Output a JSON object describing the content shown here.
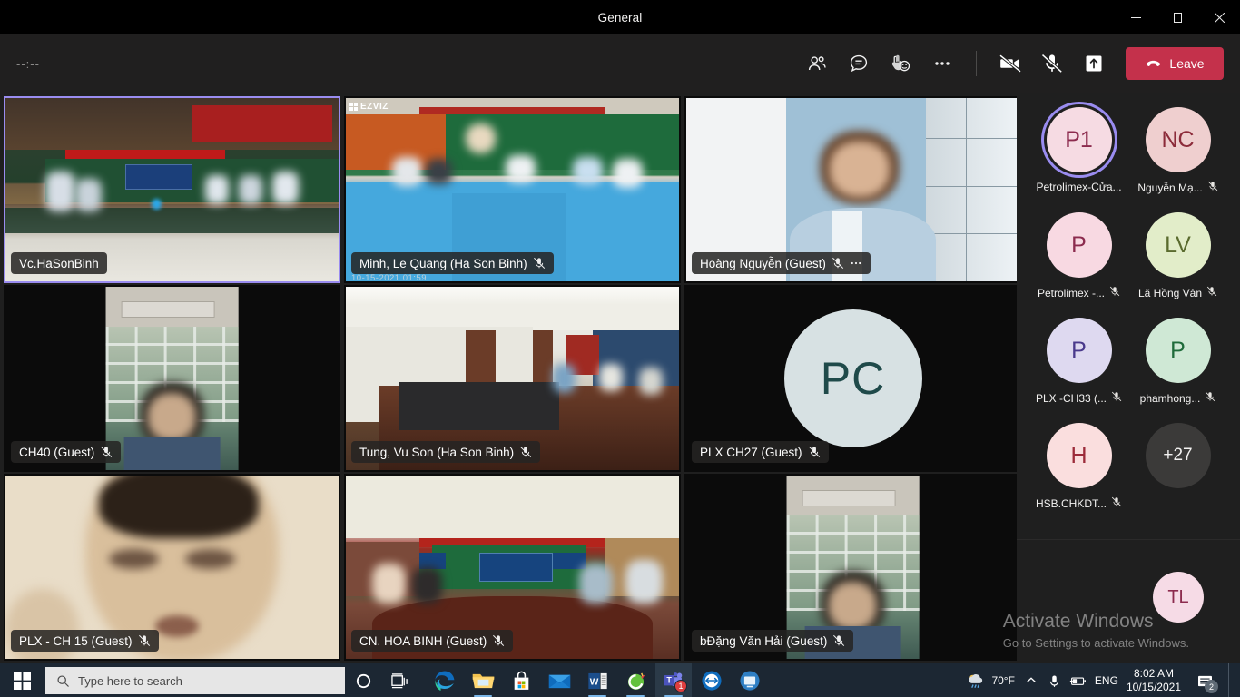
{
  "window": {
    "title": "General",
    "minimize_icon": "minimize-icon",
    "restore_icon": "restore-icon",
    "close_icon": "close-icon"
  },
  "toolbar": {
    "timer": "--:--",
    "people_label": "Show participants",
    "chat_label": "Show conversation",
    "reactions_label": "Reactions",
    "more_label": "More actions",
    "camera_label": "Turn camera on",
    "mic_label": "Unmute",
    "share_label": "Share content",
    "leave_label": "Leave",
    "leave_color": "#c4314b",
    "active_ring_color": "#9a8cf0"
  },
  "tiles": [
    {
      "name": "Vc.HaSonBinh",
      "muted": false,
      "more": false,
      "active": true,
      "scene": "s-room1",
      "layout": "full",
      "watermark": "",
      "timestamp": ""
    },
    {
      "name": "Minh, Le Quang (Ha Son Binh)",
      "muted": true,
      "more": false,
      "active": false,
      "scene": "s-room2",
      "layout": "full",
      "watermark": "EZVIZ",
      "timestamp": "10-15-2021  01:59"
    },
    {
      "name": "Hoàng Nguyễn (Guest)",
      "muted": true,
      "more": true,
      "active": false,
      "scene": "s-room3",
      "layout": "full",
      "watermark": "",
      "timestamp": ""
    },
    {
      "name": "CH40 (Guest)",
      "muted": true,
      "more": false,
      "active": false,
      "scene": "s-win",
      "layout": "portrait",
      "watermark": "",
      "timestamp": ""
    },
    {
      "name": "Tung, Vu Son (Ha Son Binh)",
      "muted": true,
      "more": false,
      "active": false,
      "scene": "s-hall",
      "layout": "full",
      "watermark": "",
      "timestamp": ""
    },
    {
      "name": "PLX CH27 (Guest)",
      "muted": true,
      "more": false,
      "active": false,
      "scene": "s-dark",
      "layout": "avatar",
      "avatar_initials": "PC",
      "avatar_bg": "#d7e1e3",
      "avatar_fg": "#1f4a4a",
      "watermark": "",
      "timestamp": ""
    },
    {
      "name": "PLX - CH 15 (Guest)",
      "muted": true,
      "more": false,
      "active": false,
      "scene": "s-face",
      "layout": "full",
      "watermark": "",
      "timestamp": ""
    },
    {
      "name": "CN. HOA BINH (Guest)",
      "muted": true,
      "more": false,
      "active": false,
      "scene": "s-meet",
      "layout": "full",
      "watermark": "",
      "timestamp": ""
    },
    {
      "name": "bĐặng Văn Hải (Guest)",
      "muted": true,
      "more": false,
      "active": false,
      "scene": "s-win",
      "layout": "portrait",
      "watermark": "",
      "timestamp": ""
    }
  ],
  "rail": {
    "participants": [
      {
        "initials": "P1",
        "label": "Petrolimex-Cửa...",
        "bg": "#f6dbe3",
        "fg": "#8c2b4e",
        "muted": false,
        "speaking": true
      },
      {
        "initials": "NC",
        "label": "Nguyễn Mạ...",
        "bg": "#efcfcf",
        "fg": "#8c2b3a",
        "muted": true,
        "speaking": false
      },
      {
        "initials": "P",
        "label": "Petrolimex -...",
        "bg": "#f8d9e2",
        "fg": "#8c2b4e",
        "muted": true,
        "speaking": false
      },
      {
        "initials": "LV",
        "label": "Lã Hồng Vân",
        "bg": "#e2edc9",
        "fg": "#5a6b2e",
        "muted": true,
        "speaking": false
      },
      {
        "initials": "P",
        "label": "PLX -CH33 (...",
        "bg": "#ded9f0",
        "fg": "#4a3a8c",
        "muted": true,
        "speaking": false
      },
      {
        "initials": "P",
        "label": "phamhong...",
        "bg": "#cfe8d5",
        "fg": "#1f6b3a",
        "muted": true,
        "speaking": false
      },
      {
        "initials": "H",
        "label": "HSB.CHKDT...",
        "bg": "#fadede",
        "fg": "#9c2b3a",
        "muted": true,
        "speaking": false
      },
      {
        "initials": "+27",
        "label": "",
        "bg": "#3b3a39",
        "fg": "#f3f2f1",
        "muted": false,
        "speaking": false,
        "overflow": true
      }
    ],
    "floating_avatar": {
      "initials": "TL",
      "bg": "#f6dbe6",
      "fg": "#8c2b4e"
    }
  },
  "activate_windows": {
    "line1": "Activate Windows",
    "line2": "Go to Settings to activate Windows."
  },
  "taskbar": {
    "start_icon": "windows-start-icon",
    "search_placeholder": "Type here to search",
    "search_icon": "search-icon",
    "cortana_icon": "cortana-icon",
    "taskview_icon": "task-view-icon",
    "apps": [
      {
        "name": "edge-icon",
        "open": false,
        "active": false,
        "badge": ""
      },
      {
        "name": "file-explorer-icon",
        "open": true,
        "active": false,
        "badge": ""
      },
      {
        "name": "microsoft-store-icon",
        "open": false,
        "active": false,
        "badge": ""
      },
      {
        "name": "mail-icon",
        "open": false,
        "active": false,
        "badge": ""
      },
      {
        "name": "word-icon",
        "open": true,
        "active": false,
        "badge": ""
      },
      {
        "name": "unikey-icon",
        "open": true,
        "active": false,
        "badge": ""
      },
      {
        "name": "teams-icon",
        "open": true,
        "active": true,
        "badge": "1"
      },
      {
        "name": "teamviewer-icon",
        "open": false,
        "active": false,
        "badge": ""
      },
      {
        "name": "remote-desktop-icon",
        "open": false,
        "active": false,
        "badge": ""
      }
    ],
    "tray": {
      "weather_icon": "weather-rain-icon",
      "temperature": "70°F",
      "chevron_icon": "chevron-up-icon",
      "mic_icon": "microphone-icon",
      "battery_icon": "battery-icon",
      "language": "ENG",
      "time": "8:02 AM",
      "date": "10/15/2021",
      "notification_icon": "notification-icon",
      "notification_count": "2"
    }
  }
}
